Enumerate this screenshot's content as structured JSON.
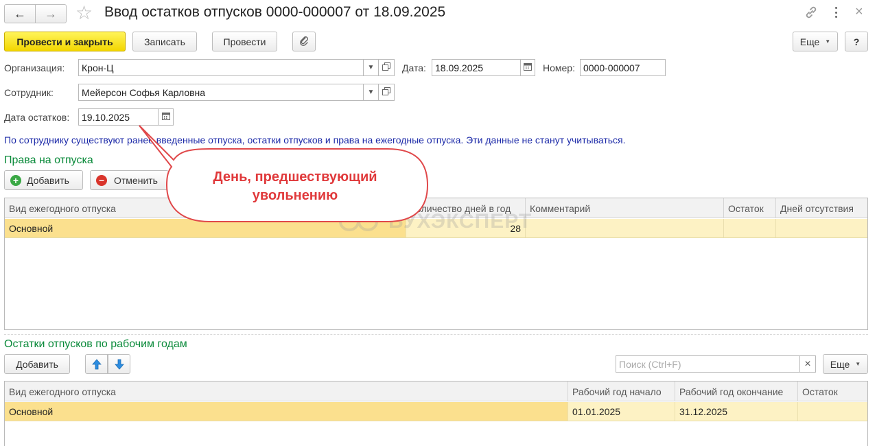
{
  "window": {
    "title": "Ввод остатков отпусков 0000-000007 от 18.09.2025"
  },
  "toolbar": {
    "post_close": "Провести и закрыть",
    "save": "Записать",
    "post": "Провести",
    "more": "Еще",
    "help": "?"
  },
  "form": {
    "org_label": "Организация:",
    "org_value": "Крон-Ц",
    "date_label": "Дата:",
    "date_value": "18.09.2025",
    "number_label": "Номер:",
    "number_value": "0000-000007",
    "employee_label": "Сотрудник:",
    "employee_value": "Мейерсон Софья Карловна",
    "balance_date_label": "Дата остатков:",
    "balance_date_value": "19.10.2025"
  },
  "warning": "По сотруднику существуют ранее введенные отпуска, остатки отпусков и права на ежегодные отпуска. Эти данные не станут учитываться.",
  "callout": {
    "text": "День, предшествующий увольнению"
  },
  "watermark": "БУХЭКСПЕРТ",
  "rights": {
    "title": "Права на отпуска",
    "add": "Добавить",
    "cancel": "Отменить",
    "columns": [
      "Вид ежегодного отпуска",
      "Количество дней в год",
      "Комментарий",
      "Остаток",
      "Дней отсутствия"
    ],
    "rows": [
      {
        "type": "Основной",
        "days": "28",
        "comment": "",
        "balance": "",
        "absent": ""
      }
    ]
  },
  "balances": {
    "title": "Остатки отпусков по рабочим годам",
    "add": "Добавить",
    "search_placeholder": "Поиск (Ctrl+F)",
    "more": "Еще",
    "columns": [
      "Вид ежегодного отпуска",
      "Рабочий год начало",
      "Рабочий год окончание",
      "Остаток"
    ],
    "rows": [
      {
        "type": "Основной",
        "start": "01.01.2025",
        "end": "31.12.2025",
        "balance": ""
      }
    ]
  }
}
